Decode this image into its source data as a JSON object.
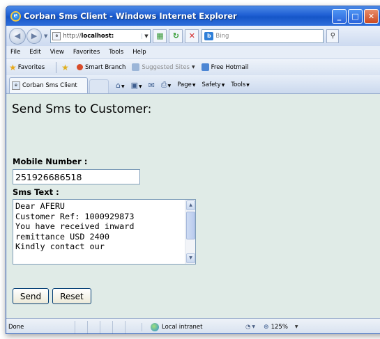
{
  "window": {
    "title": "Corban Sms Client - Windows Internet Explorer",
    "ie_icon": "ie-logo-icon",
    "caption_buttons": [
      "minimize-icon",
      "maximize-icon",
      "close-icon"
    ]
  },
  "address_bar": {
    "url_prefix": "http://",
    "url_host": "localhost:",
    "search_placeholder": "Bing"
  },
  "menu": {
    "items": [
      "File",
      "Edit",
      "View",
      "Favorites",
      "Tools",
      "Help"
    ]
  },
  "favorites_bar": {
    "favorites_label": "Favorites",
    "smart_branch": "Smart Branch",
    "suggested_sites": "Suggested Sites",
    "free_hotmail": "Free Hotmail"
  },
  "tab": {
    "label": "Corban Sms Client"
  },
  "commands": {
    "page": "Page",
    "safety": "Safety",
    "tools": "Tools"
  },
  "page": {
    "heading": "Send Sms to Customer:",
    "mobile_label": "Mobile Number :",
    "mobile_value": "251926686518",
    "sms_label": "Sms Text :",
    "sms_text": "Dear AFERU\nCustomer Ref: 1000929873\nYou have received inward\nremittance USD 2400\nKindly contact our",
    "send_button": "Send",
    "reset_button": "Reset"
  },
  "status_bar": {
    "status": "Done",
    "zone": "Local intranet",
    "zoom": "125%"
  },
  "colors": {
    "title_bar": "#1f5fd4",
    "page_background": "#e0ebe7",
    "button_border": "#003c74"
  }
}
